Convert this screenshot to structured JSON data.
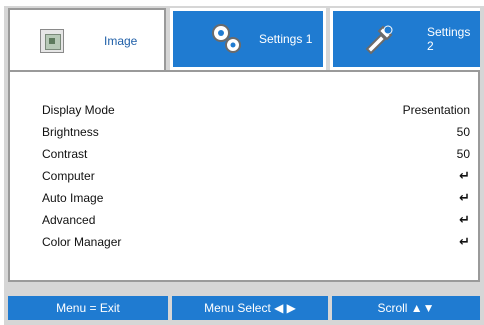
{
  "tabs": [
    {
      "label": "Image",
      "icon": "image-icon"
    },
    {
      "label": "Settings 1",
      "icon": "gears-icon"
    },
    {
      "label": "Settings 2",
      "icon": "tools-icon"
    }
  ],
  "menu": {
    "items": [
      {
        "label": "Display Mode",
        "value": "Presentation"
      },
      {
        "label": "Brightness",
        "value": "50"
      },
      {
        "label": "Contrast",
        "value": "50"
      },
      {
        "label": "Computer",
        "value": "↵"
      },
      {
        "label": "Auto Image",
        "value": "↵"
      },
      {
        "label": "Advanced",
        "value": "↵"
      },
      {
        "label": "Color Manager",
        "value": "↵"
      }
    ]
  },
  "footer": {
    "menu_exit": "Menu = Exit",
    "menu_select": "Menu Select ◀ ▶",
    "scroll": "Scroll ▲▼"
  },
  "colors": {
    "accent": "#1f7bd1",
    "panel_bg": "#ffffff",
    "frame_bg": "#d6d6d6"
  }
}
